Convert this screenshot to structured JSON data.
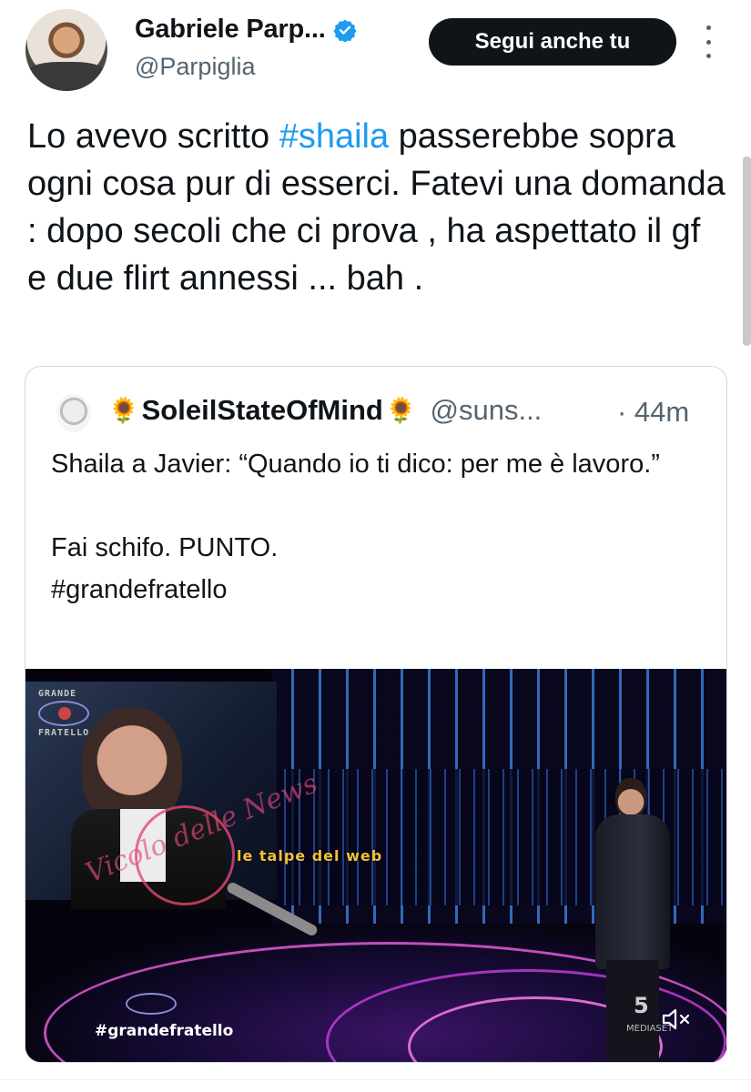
{
  "author": {
    "display_name": "Gabriele Parp...",
    "handle": "@Parpiglia",
    "verified": true
  },
  "follow_button_label": "Segui anche tu",
  "tweet": {
    "text_before": "Lo avevo scritto ",
    "hashtag": "#shaila",
    "text_after": " passerebbe sopra ogni cosa pur di esserci.  Fatevi una domanda : dopo secoli che ci prova , ha aspettato il gf e due flirt annessi ... bah ."
  },
  "quote": {
    "emoji": "🌻",
    "display_name": "SoleilStateOfMind",
    "handle": "@suns...",
    "time": "· 44m",
    "text": "Shaila a Javier: “Quando io ti dico: per me è lavoro.”\n\nFai schifo. PUNTO.\n#grandefratello"
  },
  "media": {
    "logo_line1": "GRANDE",
    "logo_line2": "FRATELLO",
    "watermark_text": "Vicolo delle News",
    "watermark_secondary": "le talpe del web",
    "hashtag_overlay": "#grandefratello",
    "channel_logo": "5",
    "channel_sub": "MEDIASET"
  },
  "colors": {
    "link": "#1d9bf0",
    "secondary_text": "#536471",
    "button_bg": "#0f1419",
    "verified": "#1d9bf0"
  }
}
